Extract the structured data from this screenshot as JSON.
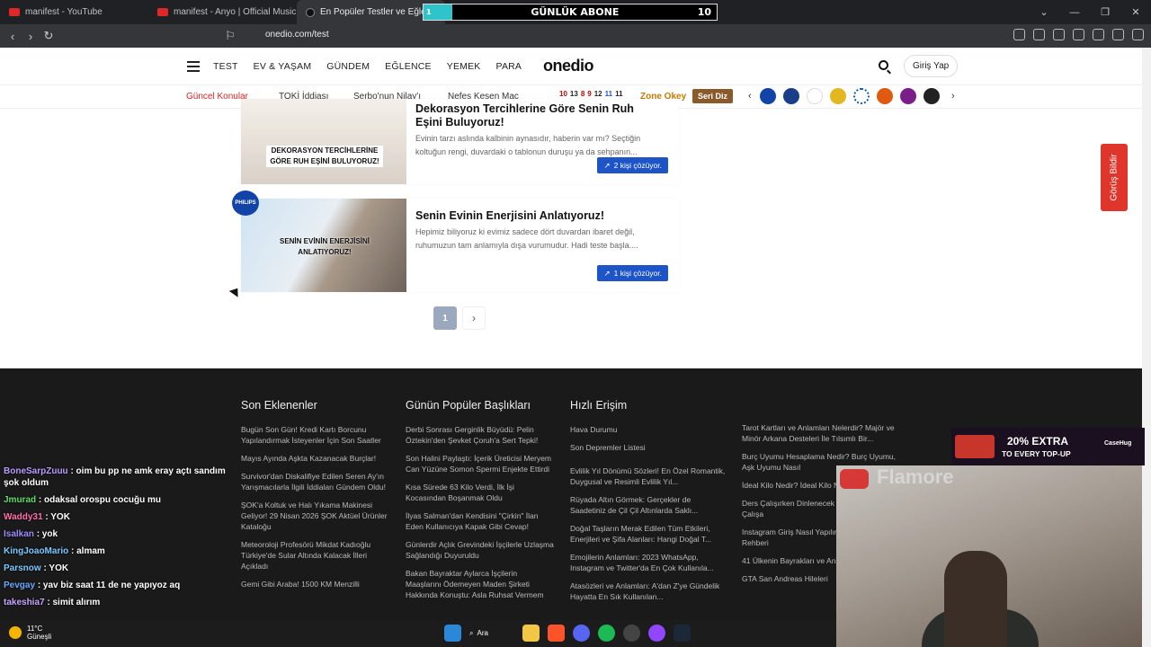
{
  "browser": {
    "tabs": [
      {
        "title": "manifest - YouTube"
      },
      {
        "title": "manifest - Anyo | Official Music Vide"
      },
      {
        "title": "En Popüler Testler ve Eğlenceli"
      }
    ],
    "url": "onedio.com/test"
  },
  "abone_widget": {
    "progress_label": "1",
    "title": "GÜNLÜK ABONE",
    "target": "10"
  },
  "site": {
    "nav": [
      "TEST",
      "EV & YAŞAM",
      "GÜNDEM",
      "EĞLENCE",
      "YEMEK",
      "PARA"
    ],
    "logo": "onedio",
    "login": "Giriş Yap",
    "hot_label": "Güncel Konular",
    "topics": [
      "TOKİ İddiası",
      "Şerbo'nun Nilay'ı",
      "Nefes Kesen Maç"
    ],
    "zone_label": "Zone Okey",
    "seri_label": "Seri Diz",
    "num_badges": [
      "10",
      "13",
      "8",
      "9",
      "12",
      "11",
      "11"
    ]
  },
  "cards": [
    {
      "title": "Dekorasyon Tercihlerine Göre Senin Ruh Eşini Buluyoruz!",
      "desc": "Evinin tarzı aslında kalbinin aynasıdır, haberin var mı? Seçtiğin koltuğun rengi, duvardaki o tablonun duruşu ya da sehpanın...",
      "caption": "DEKORASYON TERCİHLERİNE GÖRE RUH EŞİNİ BULUYORUZ!",
      "solvers": "2 kişi çözüyor."
    },
    {
      "title": "Senin Evinin Enerjisini Anlatıyoruz!",
      "desc": "Hepimiz biliyoruz ki evimiz sadece dört duvardan ibaret değil, ruhumuzun tam anlamıyla dışa vurumudur.  Hadi teste başla....",
      "caption": "SENİN EVİNİN ENERJİSİNİ ANLATIYORUZ!",
      "solvers": "1 kişi çözüyor.",
      "sponsor": "PHILIPS"
    }
  ],
  "pagination": {
    "current": "1",
    "next": "›"
  },
  "feedback": "Görüş Bildir",
  "footer": {
    "col1": {
      "title": "Son Eklenenler",
      "links": [
        "Bugün Son Gün! Kredi Kartı Borcunu Yapılandırmak İsteyenler İçin Son Saatler",
        "Mayıs Ayında Aşkta Kazanacak Burçlar!",
        "Survivor'dan Diskalifiye Edilen Seren Ay'ın Yarışmacılarla İlgili İddiaları Gündem Oldu!",
        "ŞOK'a Koltuk ve Halı Yıkama Makinesi Geliyor! 29 Nisan 2026 ŞOK Aktüel Ürünler Kataloğu",
        "Meteoroloji Profesörü Mikdat Kadıoğlu Türkiye'de Sular Altında Kalacak İlleri Açıkladı",
        "Gemi Gibi Araba! 1500 KM Menzilli"
      ]
    },
    "col2": {
      "title": "Günün Popüler Başlıkları",
      "links": [
        "Derbi Sonrası Gerginlik Büyüdü: Pelin Öztekin'den Şevket Çoruh'a Sert Tepki!",
        "Son Halini Paylaştı: İçerik Üreticisi Meryem Can Yüzüne Somon Spermi Enjekte Ettirdi",
        "Kısa Sürede 63 Kilo Verdi, İlk İşi Kocasından Boşanmak Oldu",
        "İlyas Salman'dan Kendisini \"Çirkin\" İlan Eden Kullanıcıya Kapak Gibi Cevap!",
        "Günlerdir Açlık Grevindeki İşçilerle Uzlaşma Sağlandığı Duyuruldu",
        "Bakan Bayraktar Aylarca İşçilerin Maaşlarını Ödemeyen Maden Şirketi Hakkında Konuştu: Asla Ruhsat Vermem"
      ]
    },
    "col3": {
      "title": "Hızlı Erişim",
      "links": [
        "Hava Durumu",
        "Son Depremler Listesi",
        "Evlilik Yıl Dönümü Sözleri! En Özel Romantik, Duygusal ve Resimli Evlilik Yıl...",
        "Rüyada Altın Görmek: Gerçekler de Saadetiniz de Çil Çil Altınlarda Saklı...",
        "Doğal Taşların Merak Edilen Tüm Etkileri, Enerjileri ve Şifa Alanları: Hangi Doğal T...",
        "Emojilerin Anlamları: 2023 WhatsApp, Instagram ve Twitter'da En Çok Kullanıla...",
        "Atasözleri ve Anlamları: A'dan Z'ye Gündelik Hayatta En Sık Kullanılan..."
      ]
    },
    "col4": {
      "links": [
        "Tarot Kartları ve Anlamları Nelerdir? Majör ve Minör Arkana Desteleri İle Tılsımlı Bir...",
        "Burç Uyumu Hesaplama Nedir? Burç Uyumu, Aşk Uyumu Nasıl",
        "İdeal Kilo Nedir? İdeal Kilo Nasıl Yapılır?",
        "Ders Çalışırken Dinlenecek Neler? Müziksiz Çalışa",
        "Instagram Giriş Nasıl Yapılır? Giriş İşlemleri Rehberi",
        "41 Ülkenin Bayrakları ve Anlamları",
        "GTA San Andreas Hileleri"
      ]
    }
  },
  "chat": [
    {
      "user": "BoneSarpZuuu",
      "msg": ": oim bu pp ne amk eray açtı sandım şok oldum",
      "color": "#b99cff"
    },
    {
      "user": "Jmurad",
      "msg": ": odaksal orospu cocuğu mu",
      "color": "#5ddc6b"
    },
    {
      "user": "Waddy31",
      "msg": ": YOK",
      "color": "#ff6fa8"
    },
    {
      "user": "Isalkan",
      "msg": ": yok",
      "color": "#9c8cff"
    },
    {
      "user": "KingJoaoMario",
      "msg": ": almam",
      "color": "#7cc7ff"
    },
    {
      "user": "Parsnow",
      "msg": ": YOK",
      "color": "#7cc7ff"
    },
    {
      "user": "Pevgay",
      "msg": ": yav biz saat 11 de ne yapıyoz aq",
      "color": "#6aa8ff"
    },
    {
      "user": "takeshia7",
      "msg": ": simit alırım",
      "color": "#c7a6ff"
    }
  ],
  "promo": {
    "big": "20% EXTRA",
    "small": "TO EVERY TOP-UP",
    "brand": "CaseHug"
  },
  "webcam": {
    "watermark": "Flamore"
  },
  "taskbar": {
    "temp": "11°C",
    "weather": "Güneşli",
    "search": "Ara"
  }
}
